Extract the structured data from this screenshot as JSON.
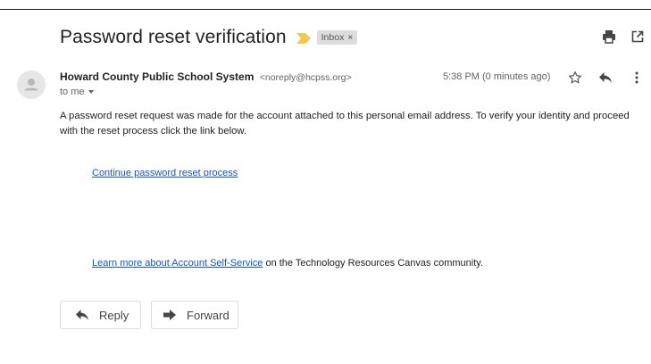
{
  "email": {
    "subject": "Password reset verification",
    "label": "Inbox",
    "label_close": "×",
    "sender_name": "Howard County Public School System",
    "sender_email": "<noreply@hcpss.org>",
    "recipient": "to me",
    "timestamp": "5:38 PM (0 minutes ago)",
    "body_paragraph": "A password reset request was made for the account attached to this personal email address. To verify your identity and proceed with the reset process click the link below.",
    "reset_link": "Continue password reset process",
    "learn_link": "Learn more about Account Self-Service",
    "learn_suffix": " on the Technology Resources Canvas community."
  },
  "actions": {
    "reply_label": "Reply",
    "forward_label": "Forward"
  },
  "icons": {
    "importance": "importance-marker-icon",
    "print": "print-icon",
    "popout": "open-in-new-window-icon",
    "avatar": "person-avatar-icon",
    "star": "star-icon",
    "reply": "reply-icon",
    "more": "more-vertical-icon",
    "forward": "forward-icon"
  },
  "colors": {
    "link": "#1155cc",
    "importance": "#f2c94c",
    "label_chip_bg": "#dddddd",
    "muted_text": "#5f6368"
  }
}
